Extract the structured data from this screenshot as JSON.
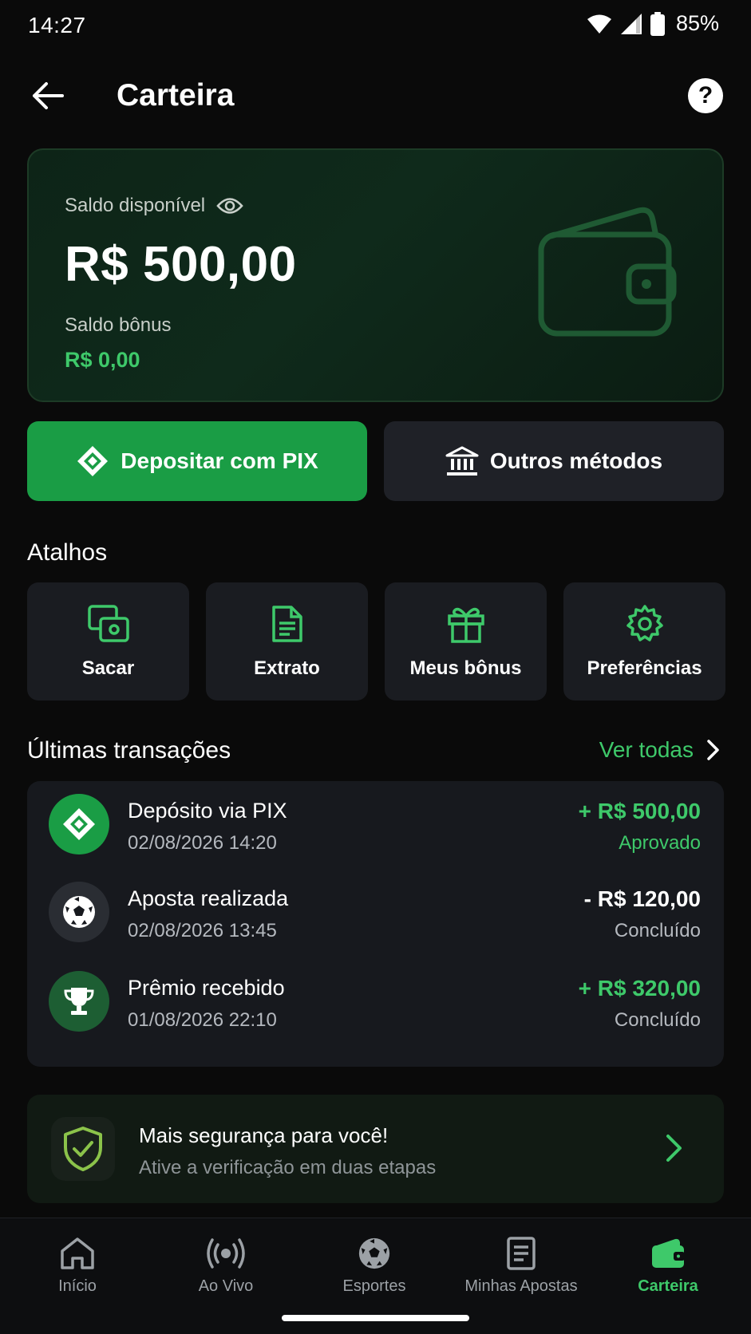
{
  "status_bar": {
    "time": "14:27",
    "battery": "85%"
  },
  "header": {
    "title": "Carteira"
  },
  "balance": {
    "label": "Saldo disponível",
    "amount": "R$ 500,00",
    "bonus_label": "Saldo bônus",
    "bonus_amount": "R$ 0,00"
  },
  "actions": {
    "pix_label": "Depositar com PIX",
    "other_label": "Outros métodos"
  },
  "shortcuts": {
    "title": "Atalhos",
    "items": [
      {
        "label": "Sacar",
        "icon": "withdraw-icon"
      },
      {
        "label": "Extrato",
        "icon": "document-icon"
      },
      {
        "label": "Meus bônus",
        "icon": "gift-icon"
      },
      {
        "label": "Preferências",
        "icon": "gear-icon"
      }
    ]
  },
  "transactions": {
    "title": "Últimas transações",
    "see_all": "Ver todas",
    "items": [
      {
        "title": "Depósito via PIX",
        "date": "02/08/2026 14:20",
        "amount": "+ R$ 500,00",
        "status": "Aprovado",
        "icon": "pix-icon"
      },
      {
        "title": "Aposta realizada",
        "date": "02/08/2026 13:45",
        "amount": "- R$ 120,00",
        "status": "Concluído",
        "icon": "soccer-ball-icon"
      },
      {
        "title": "Prêmio recebido",
        "date": "01/08/2026 22:10",
        "amount": "+ R$ 320,00",
        "status": "Concluído",
        "icon": "trophy-icon"
      }
    ]
  },
  "security": {
    "title": "Mais segurança para você!",
    "subtitle": "Ative a verificação em duas etapas"
  },
  "nav": {
    "items": [
      {
        "label": "Início",
        "icon": "home-icon"
      },
      {
        "label": "Ao Vivo",
        "icon": "live-icon"
      },
      {
        "label": "Esportes",
        "icon": "soccer-ball-icon"
      },
      {
        "label": "Minhas Apostas",
        "icon": "bets-icon"
      },
      {
        "label": "Carteira",
        "icon": "wallet-icon"
      }
    ],
    "active": "Carteira"
  },
  "colors": {
    "accent": "#3ec96a",
    "pix_button": "#1a9d45",
    "background": "#0a0a0a",
    "card": "#17191e"
  }
}
